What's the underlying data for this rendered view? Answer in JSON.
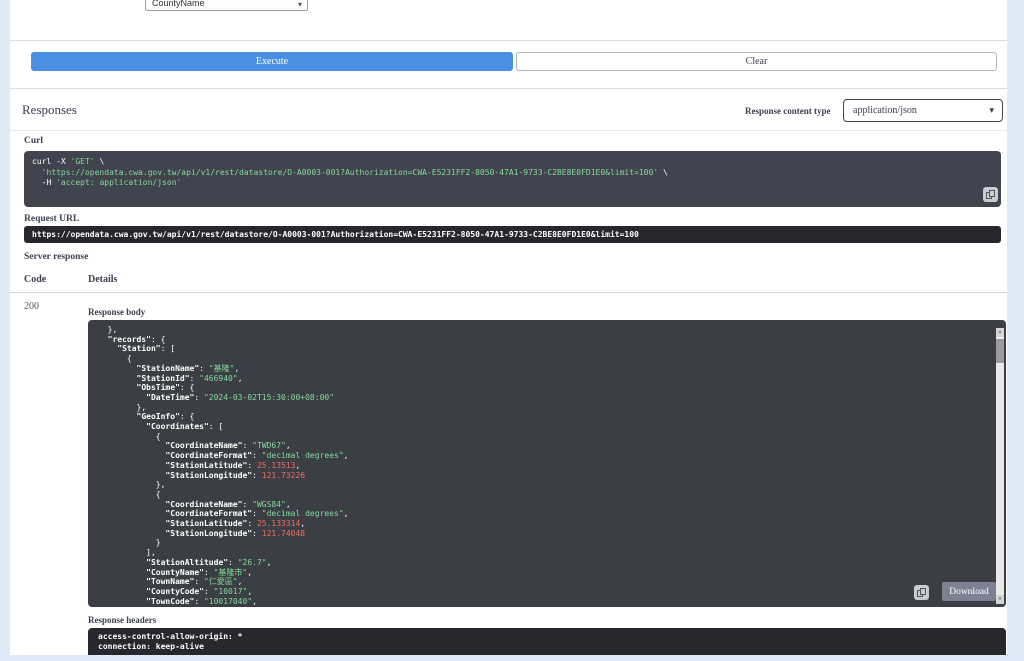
{
  "icons": {
    "chevron_down": "▾",
    "scroll_up": "▴",
    "scroll_down": "▾"
  },
  "parameters": {
    "select_value": "CountyName"
  },
  "actions": {
    "execute_label": "Execute",
    "clear_label": "Clear"
  },
  "responses": {
    "title": "Responses",
    "content_type_label": "Response content type",
    "content_type_value": "application/json",
    "curl_label": "Curl",
    "request_url_label": "Request URL",
    "request_url_value": "https://opendata.cwa.gov.tw/api/v1/rest/datastore/O-A0003-001?Authorization=CWA-E5231FF2-8050-47A1-9733-C2BE8E0FD1E0&limit=100",
    "server_response_label": "Server response",
    "table": {
      "code_header": "Code",
      "details_header": "Details"
    },
    "status_code": "200",
    "response_body_label": "Response body",
    "download_label": "Download",
    "response_headers_label": "Response headers"
  },
  "curl_lines": [
    [
      [
        "p",
        "curl -X "
      ],
      [
        "s",
        "'GET'"
      ],
      [
        "p",
        " \\"
      ]
    ],
    [
      [
        "s",
        "  'https://opendata.cwa.gov.tw/api/v1/rest/datastore/O-A0003-001?Authorization=CWA-E5231FF2-8050-47A1-9733-C2BE8E0FD1E0&limit=100'"
      ],
      [
        "p",
        " \\"
      ]
    ],
    [
      [
        "p",
        "  -H "
      ],
      [
        "s",
        "'accept: application/json'"
      ]
    ]
  ],
  "response_body_lines": [
    [
      [
        "p",
        "  },"
      ]
    ],
    [
      [
        "k",
        "  \"records\""
      ],
      [
        "p",
        ": {"
      ]
    ],
    [
      [
        "k",
        "    \"Station\""
      ],
      [
        "p",
        ": ["
      ]
    ],
    [
      [
        "p",
        "      {"
      ]
    ],
    [
      [
        "k",
        "        \"StationName\""
      ],
      [
        "p",
        ": "
      ],
      [
        "s",
        "\"基隆\""
      ],
      [
        "p",
        ","
      ]
    ],
    [
      [
        "k",
        "        \"StationId\""
      ],
      [
        "p",
        ": "
      ],
      [
        "s",
        "\"466940\""
      ],
      [
        "p",
        ","
      ]
    ],
    [
      [
        "k",
        "        \"ObsTime\""
      ],
      [
        "p",
        ": {"
      ]
    ],
    [
      [
        "k",
        "          \"DateTime\""
      ],
      [
        "p",
        ": "
      ],
      [
        "s",
        "\"2024-03-02T15:30:00+08:00\""
      ]
    ],
    [
      [
        "p",
        "        },"
      ]
    ],
    [
      [
        "k",
        "        \"GeoInfo\""
      ],
      [
        "p",
        ": {"
      ]
    ],
    [
      [
        "k",
        "          \"Coordinates\""
      ],
      [
        "p",
        ": ["
      ]
    ],
    [
      [
        "p",
        "            {"
      ]
    ],
    [
      [
        "k",
        "              \"CoordinateName\""
      ],
      [
        "p",
        ": "
      ],
      [
        "s",
        "\"TWD67\""
      ],
      [
        "p",
        ","
      ]
    ],
    [
      [
        "k",
        "              \"CoordinateFormat\""
      ],
      [
        "p",
        ": "
      ],
      [
        "s",
        "\"decimal degrees\""
      ],
      [
        "p",
        ","
      ]
    ],
    [
      [
        "k",
        "              \"StationLatitude\""
      ],
      [
        "p",
        ": "
      ],
      [
        "n",
        "25.13513"
      ],
      [
        "p",
        ","
      ]
    ],
    [
      [
        "k",
        "              \"StationLongitude\""
      ],
      [
        "p",
        ": "
      ],
      [
        "n",
        "121.73226"
      ]
    ],
    [
      [
        "p",
        "            },"
      ]
    ],
    [
      [
        "p",
        "            {"
      ]
    ],
    [
      [
        "k",
        "              \"CoordinateName\""
      ],
      [
        "p",
        ": "
      ],
      [
        "s",
        "\"WGS84\""
      ],
      [
        "p",
        ","
      ]
    ],
    [
      [
        "k",
        "              \"CoordinateFormat\""
      ],
      [
        "p",
        ": "
      ],
      [
        "s",
        "\"decimal degrees\""
      ],
      [
        "p",
        ","
      ]
    ],
    [
      [
        "k",
        "              \"StationLatitude\""
      ],
      [
        "p",
        ": "
      ],
      [
        "n",
        "25.133314"
      ],
      [
        "p",
        ","
      ]
    ],
    [
      [
        "k",
        "              \"StationLongitude\""
      ],
      [
        "p",
        ": "
      ],
      [
        "n",
        "121.74048"
      ]
    ],
    [
      [
        "p",
        "            }"
      ]
    ],
    [
      [
        "p",
        "          ],"
      ]
    ],
    [
      [
        "k",
        "          \"StationAltitude\""
      ],
      [
        "p",
        ": "
      ],
      [
        "s",
        "\"26.7\""
      ],
      [
        "p",
        ","
      ]
    ],
    [
      [
        "k",
        "          \"CountyName\""
      ],
      [
        "p",
        ": "
      ],
      [
        "s",
        "\"基隆市\""
      ],
      [
        "p",
        ","
      ]
    ],
    [
      [
        "k",
        "          \"TownName\""
      ],
      [
        "p",
        ": "
      ],
      [
        "s",
        "\"仁愛區\""
      ],
      [
        "p",
        ","
      ]
    ],
    [
      [
        "k",
        "          \"CountyCode\""
      ],
      [
        "p",
        ": "
      ],
      [
        "s",
        "\"10017\""
      ],
      [
        "p",
        ","
      ]
    ],
    [
      [
        "k",
        "          \"TownCode\""
      ],
      [
        "p",
        ": "
      ],
      [
        "s",
        "\"10017040\""
      ],
      [
        "p",
        ","
      ]
    ]
  ],
  "response_headers_lines": [
    "access-control-allow-origin: *",
    "connection: keep-alive"
  ]
}
